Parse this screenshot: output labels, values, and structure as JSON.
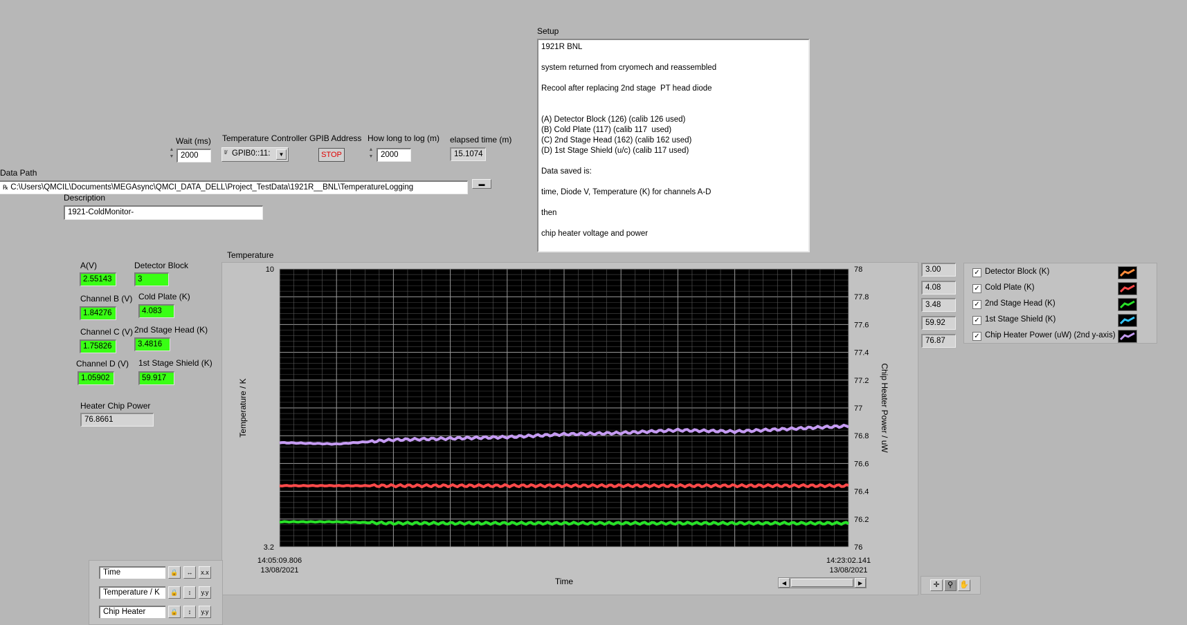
{
  "setup": {
    "label": "Setup",
    "lines": [
      "1921R BNL",
      "",
      "system returned from cryomech and reassembled",
      "",
      "Recool after replacing 2nd stage  PT head diode",
      "",
      "",
      "(A) Detector Block (126) (calib 126 used)",
      "(B) Cold Plate (117) (calib 117  used)",
      "(C) 2nd Stage Head (162) (calib 162 used)",
      "(D) 1st Stage Shield (u/c) (calib 117 used)",
      "",
      "Data saved is:",
      "",
      "time, Diode V, Temperature (K) for channels A-D",
      "",
      "then",
      "",
      "chip heater voltage and power"
    ]
  },
  "controls": {
    "wait_label": "Wait (ms)",
    "wait_value": "2000",
    "gpib_label": "Temperature Controller GPIB Address",
    "gpib_prefix": "I/",
    "gpib_value": "GPIB0::11:",
    "stop_label": "STOP",
    "howlong_label": "How long to log (m)",
    "howlong_value": "2000",
    "elapsed_label": "elapsed time  (m)",
    "elapsed_value": "15.1074",
    "datapath_label": "Data Path",
    "datapath_prefix": "℞",
    "datapath_value": "C:\\Users\\QMCIL\\Documents\\MEGAsync\\QMCI_DATA_DELL\\Project_TestData\\1921R__BNL\\TemperatureLogging",
    "description_label": "Description",
    "description_value": "1921-ColdMonitor-"
  },
  "readings": {
    "a_label": "A(V)",
    "a_value": "2.55143",
    "b_label": "Channel B (V)",
    "b_value": "1.84276",
    "c_label": "Channel C (V)",
    "c_value": "1.75826",
    "d_label": "Channel D (V)",
    "d_value": "1.05902",
    "detector_label": "Detector Block",
    "detector_value": "3",
    "coldplate_label": "Cold Plate (K)",
    "coldplate_value": "4.083",
    "stage2_label": "2nd Stage Head (K)",
    "stage2_value": "3.4816",
    "stage1_label": "1st Stage Shield (K)",
    "stage1_value": "59.917",
    "heater_label": "Heater Chip Power",
    "heater_value": "76.8661"
  },
  "legend": {
    "readouts": [
      "3.00",
      "4.08",
      "3.48",
      "59.92",
      "76.87"
    ],
    "items": [
      {
        "name": "Detector Block (K)",
        "color": "#ff8c3a"
      },
      {
        "name": "Cold Plate (K)",
        "color": "#ff4a4a"
      },
      {
        "name": "2nd Stage Head (K)",
        "color": "#28e028"
      },
      {
        "name": "1st Stage Shield (K)",
        "color": "#33c6ff"
      },
      {
        "name": "Chip Heater Power (uW)  (2nd y-axis)",
        "color": "#c59bf2"
      }
    ]
  },
  "scales": {
    "time": "Time",
    "temperature": "Temperature / K",
    "heater": "Chip Heater"
  },
  "chart_data": {
    "type": "line",
    "title": "Temperature",
    "xlabel": "Time",
    "ylabel": "Temperature / K",
    "y2label": "Chip Heater Power / uW",
    "x_start": "14:05:09.806",
    "x_start_date": "13/08/2021",
    "x_end": "14:23:02.141",
    "x_end_date": "13/08/2021",
    "ylim": [
      3.2,
      10
    ],
    "y_ticks": [
      "10",
      "3.2"
    ],
    "y2lim": [
      76,
      78
    ],
    "y2_ticks": [
      "78",
      "77.8",
      "77.6",
      "77.4",
      "77.2",
      "77",
      "76.8",
      "76.6",
      "76.4",
      "76.2",
      "76"
    ],
    "grid": true,
    "series": [
      {
        "name": "Cold Plate (K)",
        "axis": "right",
        "color": "#ff4a4a",
        "values": [
          76.44,
          76.44,
          76.44,
          76.44,
          76.44,
          76.44,
          76.44,
          76.44,
          76.44,
          76.44,
          76.44
        ]
      },
      {
        "name": "2nd Stage Head (K)",
        "axis": "right",
        "color": "#28e028",
        "values": [
          76.18,
          76.18,
          76.17,
          76.17,
          76.17,
          76.17,
          76.17,
          76.17,
          76.17,
          76.17,
          76.17
        ]
      },
      {
        "name": "Chip Heater Power (uW)  (2nd y-axis)",
        "axis": "right",
        "color": "#c59bf2",
        "values": [
          76.75,
          76.74,
          76.77,
          76.78,
          76.79,
          76.81,
          76.82,
          76.84,
          76.83,
          76.85,
          76.87
        ]
      }
    ]
  }
}
